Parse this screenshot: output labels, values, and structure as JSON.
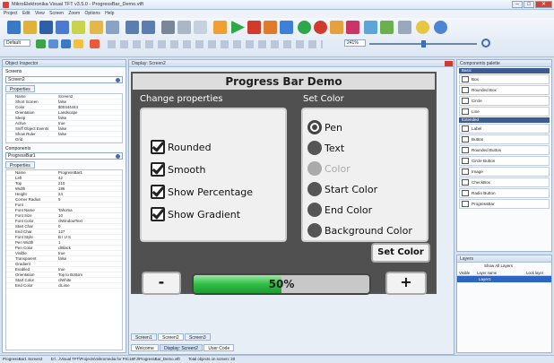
{
  "window": {
    "title": "MikroElektronika Visual TFT v3.5.0 - ProgressBar_Demo.vtft",
    "min": "–",
    "max": "□",
    "close": "✕"
  },
  "menu": [
    "Project",
    "Edit",
    "View",
    "Screen",
    "Zoom",
    "Options",
    "Help"
  ],
  "toolbar": {
    "font_label": "Default",
    "zoom_value": "241%"
  },
  "object_inspector": {
    "title": "Object Inspector",
    "screens_label": "Screens",
    "screen_value": "Screen2",
    "properties_tab": "Properties",
    "screen_props": [
      [
        "Name",
        "Screen2"
      ],
      [
        "Short Screen",
        "false"
      ],
      [
        "Color",
        "$00444444"
      ],
      [
        "Orientation",
        "Landscape"
      ],
      [
        "Sleep",
        "false"
      ],
      [
        "Active",
        "true"
      ],
      [
        "Sniff Object Events",
        "false"
      ],
      [
        "Show Ruler",
        "false"
      ],
      [
        "Grid",
        ""
      ]
    ],
    "components_label": "Components",
    "component_value": "ProgressBar1",
    "component_props": [
      [
        "Name",
        "ProgressBar1"
      ],
      [
        "Left",
        "42"
      ],
      [
        "Top",
        "210"
      ],
      [
        "Width",
        "186"
      ],
      [
        "Height",
        "24"
      ],
      [
        "Corner Radius",
        "5"
      ],
      [
        "Font",
        ""
      ],
      [
        "Font Name",
        "Tahoma"
      ],
      [
        "Font Size",
        "10"
      ],
      [
        "Font Color",
        "clWindowText"
      ],
      [
        "Start Char",
        "0"
      ],
      [
        "End Char",
        "127"
      ],
      [
        "Font Style",
        "B I U S"
      ],
      [
        "Pen Width",
        "1"
      ],
      [
        "Pen Color",
        "clBlack"
      ],
      [
        "Visible",
        "true"
      ],
      [
        "Transparent",
        "false"
      ],
      [
        "Gradient",
        ""
      ],
      [
        "Enabled",
        "true"
      ],
      [
        "Orientation",
        "Top to Bottom"
      ],
      [
        "Start Color",
        "clWhite"
      ],
      [
        "End Color",
        "clLime"
      ]
    ]
  },
  "display": {
    "tab_title": "Display: Screen2",
    "app_title": "Progress Bar Demo",
    "change_props_label": "Change properties",
    "set_color_label": "Set Color",
    "checkboxes": [
      "Rounded",
      "Smooth",
      "Show Percentage",
      "Show Gradient"
    ],
    "radios": [
      "Pen",
      "Text",
      "Color",
      "Start Color",
      "End Color",
      "Background Color"
    ],
    "set_color_button": "Set Color",
    "minus_button": "-",
    "plus_button": "+",
    "progress_text": "50%",
    "progress_value": 0.5,
    "screen_tabs": [
      "Screen1",
      "Screen2",
      "Screen3"
    ],
    "doc_tabs": [
      "Welcome",
      "Display: Screen2",
      "User Code"
    ]
  },
  "palette": {
    "title": "Components palette",
    "basic_label": "Basic",
    "basic_items": [
      "Box",
      "Rounded Box",
      "Circle",
      "Line"
    ],
    "extended_label": "Extended",
    "extended_items": [
      "Label",
      "Button",
      "Rounded Button",
      "Circle Button",
      "Image",
      "CheckBox",
      "Radio Button",
      "ProgressBar"
    ]
  },
  "layers": {
    "title": "Layers",
    "show_all": "Show All Layers",
    "cols": [
      "Visible",
      "Layer name",
      "Lock layer"
    ],
    "row": "Layer1"
  },
  "status": {
    "screen": "ProgressBar1  Screen2",
    "path": "D:\\...\\Visual TFT\\Projects\\mikromedia for PIC18FJ\\ProgressBar_Demo.vtft",
    "objects": "Total objects on screen: 20"
  },
  "colors": {
    "accent": "#2b66c6",
    "progress": "#2fbf45",
    "device_bg": "#505050"
  }
}
